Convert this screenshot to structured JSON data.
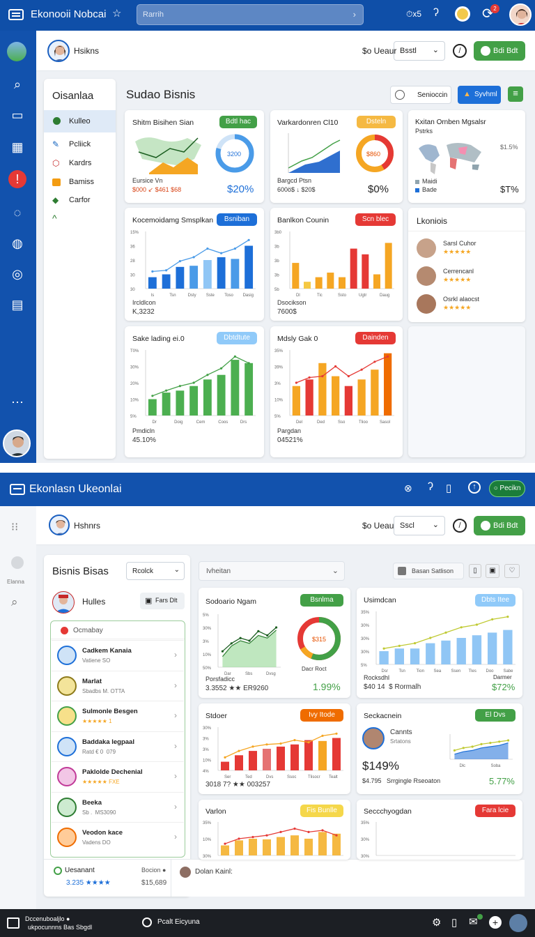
{
  "top": {
    "app_title": "Ekonooii Nobcai",
    "search_placeholder": "Rarrih",
    "status_text": "⏱x5",
    "notif_count": "2"
  },
  "header": {
    "user_name": "Hsikns",
    "currency": "$o Ueaur",
    "select_value": "Bsstl",
    "action_btn": "Bdi Bdt"
  },
  "sidebar": {
    "title": "Oisanlaa",
    "items": [
      "Kulleo",
      "Pcliick",
      "Kardrs",
      "Bamiss",
      "Carfor"
    ]
  },
  "main": {
    "title": "Sudao Bisnis",
    "btn1": "Senioccin",
    "btn2": "Syvhml"
  },
  "cards": {
    "c1": {
      "title": "Shitm Bisihen Sian",
      "pill": "Bdtl hac",
      "donut_val": "3200",
      "foot_label": "Eursice Vn",
      "foot_val": "$000 ↙ $461 $68",
      "big": "$20%"
    },
    "c2": {
      "title": "Varkardonren Cl10",
      "pill": "Dsteln",
      "donut_val": "$860",
      "foot_label": "Bargcd Ptsn",
      "foot_val": "600ö$ ↓ $20$",
      "big": "$0%"
    },
    "c3": {
      "title": "Kxitan Ornben Mgsalsr",
      "subtitle": "Pstrks",
      "legend1": "Maidi",
      "legend2": "Bade",
      "pct": "$1.5%",
      "big": "$T%"
    },
    "c4": {
      "title": "Kocemoidamg Smsplkan",
      "pill": "Bsniban",
      "foot_label": "Ircldlcon",
      "foot_val": "K,3232",
      "yt": [
        "15%",
        "36",
        "28",
        "30",
        "30"
      ],
      "xt": [
        "ls",
        "Tsn",
        "Dsty",
        "Sste",
        "Toso",
        "Dasig"
      ]
    },
    "c5": {
      "title": "Banlkon Counin",
      "pill": "Scn blec",
      "foot_label": "Dsocikson",
      "foot_val": "7600$",
      "yt": [
        "3b0",
        "3b",
        "3b",
        "3b",
        "5b"
      ],
      "xt": [
        "Dl",
        "Tic",
        "Ssto",
        "Ugtr",
        "Daug"
      ]
    },
    "c6": {
      "title": "Lkoniois",
      "people": [
        {
          "name": "Sarsl Cuhor"
        },
        {
          "name": "Cerrencanl"
        },
        {
          "name": "Osrkl alaocst"
        }
      ]
    },
    "c7": {
      "title": "Sake lading ei.0",
      "pill": "Dbtdtute",
      "foot_label": "Pmdicln",
      "foot_val": "45.10%",
      "yt": [
        "T0%",
        "30%",
        "20%",
        "10%",
        "5%"
      ],
      "xt": [
        "Dr",
        "Doig",
        "Cem",
        "Coos",
        "Drs"
      ]
    },
    "c8": {
      "title": "Mdsly Gak 0",
      "pill": "Dainden",
      "foot_label": "Pargdan",
      "foot_val": "04521%",
      "yt": [
        "35%",
        "39%",
        "3%",
        "10%",
        "5%"
      ],
      "xt": [
        "Del",
        "Ded",
        "Sso",
        "Tlioo",
        "Sasol"
      ]
    }
  },
  "top2": {
    "app_title": "Ekonlasn Ukeonlai",
    "btn": "Pecikn"
  },
  "header2": {
    "user_name": "Hshnrs",
    "currency": "$o Ueau",
    "select_value": "Sscl",
    "action_btn": "Bdi Bdt"
  },
  "side2": {
    "label": "Elanna"
  },
  "left2": {
    "title": "Bisnis Bisas",
    "select": "Rcolck",
    "person": "Hulles",
    "btn": "Fars Dlt",
    "search": "Ocmabay",
    "rows": [
      {
        "title": "Cadkem Kanaia",
        "sub": "Vatiene SO"
      },
      {
        "title": "Marlat",
        "sub": "Sbadbs M. OTTA"
      },
      {
        "title": "Sulmonle Besgen",
        "sub": "★★★★★ 1"
      },
      {
        "title": "Baddaka legpaal",
        "sub": "Ratd € 0  079"
      },
      {
        "title": "Paklolde Dechenial",
        "sub": "★★★★★ FXE"
      },
      {
        "title": "Beeka",
        "sub": "Sb .  MS3090"
      },
      {
        "title": "Veodon kace",
        "sub": "Vadens DO"
      }
    ],
    "foot_name": "Uesanant",
    "foot_val": "3.235 ★★★★",
    "foot_r_label": "Bocion ●",
    "foot_r_val": "$15,689",
    "foot_person": "Dolan Kainl:"
  },
  "filter": {
    "select": "Ivheitan",
    "right": "Basan Satlison"
  },
  "cards2": {
    "d1": {
      "title": "Sodoario Ngam",
      "pill": "Bsnlma",
      "donut_val": "$315",
      "foot_label": "Porsfadicc",
      "foot_val": "3.3552 ★★ ER9260",
      "foot_mid": "Dacr Roct",
      "big": "1.99%",
      "yt": [
        "5%",
        "30%",
        "3%",
        "10%",
        "50%"
      ],
      "xt": [
        "Dar",
        "Sbs",
        "Dvsg"
      ]
    },
    "d2": {
      "title": "Usimdcan",
      "pill": "Dbts Itee",
      "foot_label": "Rocksdhl",
      "foot_val": "$40 14  $ Rormalh",
      "foot_r": "Darmer",
      "big": "$72%",
      "yt": [
        "35%",
        "30%",
        "30%",
        "30%",
        "5%"
      ],
      "xt": [
        "Dsr",
        "Tsn",
        "Tion",
        "Sea",
        "Ssen",
        "Tles",
        "Doo",
        "Sabe"
      ]
    },
    "d3": {
      "title": "Stdoer",
      "pill": "Ivy Itode",
      "foot_val": "3018 7? ★★ 003257",
      "yt": [
        "30%",
        "3%",
        "3%",
        "10%",
        "4%"
      ],
      "xt": [
        "Ser",
        "Ted",
        "Dvs",
        "Ssoc",
        "Tlisocr",
        "Tealt"
      ]
    },
    "d4": {
      "title": "Seckacnein",
      "pill": "El Dvs",
      "person": "Cannts",
      "person_sub": "Srtatons",
      "big": "$149%",
      "foot_val": "$4.795   Srrgingle Rseoaton",
      "big2": "5.77%",
      "xt": [
        "Dlc",
        "Soba"
      ]
    },
    "d5": {
      "title": "Varlon",
      "pill": "Fis Bunlle",
      "yt": [
        "35%",
        "10%",
        "30%"
      ]
    },
    "d6": {
      "title": "Seccchyogdan",
      "pill": "Fara lcie",
      "yt": [
        "35%",
        "30%",
        "30%"
      ]
    }
  },
  "bottom": {
    "left": "Dccenuboaljlo ●",
    "left2": "    ukpocunnns Bas Sbgdl",
    "mid": "Pcalt Eicyuna"
  },
  "colors": {
    "blue": "#0f4fa8",
    "green": "#4caf50",
    "orange": "#f5a623",
    "red": "#e53935"
  }
}
